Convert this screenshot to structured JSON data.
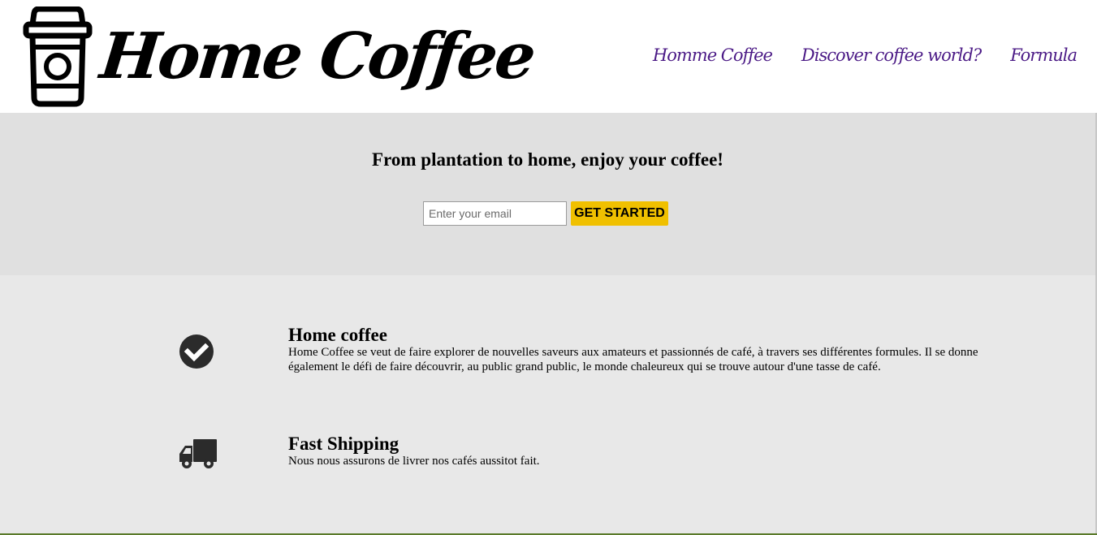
{
  "brand": {
    "name": "Home Coffee",
    "logo_icon": "coffee-cup-icon"
  },
  "nav": {
    "items": [
      {
        "label": "Homme Coffee"
      },
      {
        "label": "Discover coffee world?"
      },
      {
        "label": "Formula"
      }
    ],
    "color": "#4b1a86"
  },
  "hero": {
    "headline": "From plantation to home, enjoy your coffee!",
    "email_placeholder": "Enter your email",
    "email_value": "",
    "cta_label": "GET STARTED",
    "cta_color": "#f0c000",
    "background": "#e0e0e0"
  },
  "features": {
    "background": "#e8e8e8",
    "items": [
      {
        "icon": "check-circle-icon",
        "title": "Home coffee",
        "text": "Home Coffee se veut de faire explorer de nouvelles saveurs aux amateurs et passionnés de café, à travers ses différentes formules. Il se donne également le défi de faire découvrir, au public grand public, le monde chaleureux qui se trouve autour d'une tasse de café."
      },
      {
        "icon": "truck-icon",
        "title": "Fast Shipping",
        "text": "Nous nous assurons de livrer nos cafés aussitot fait."
      }
    ]
  }
}
